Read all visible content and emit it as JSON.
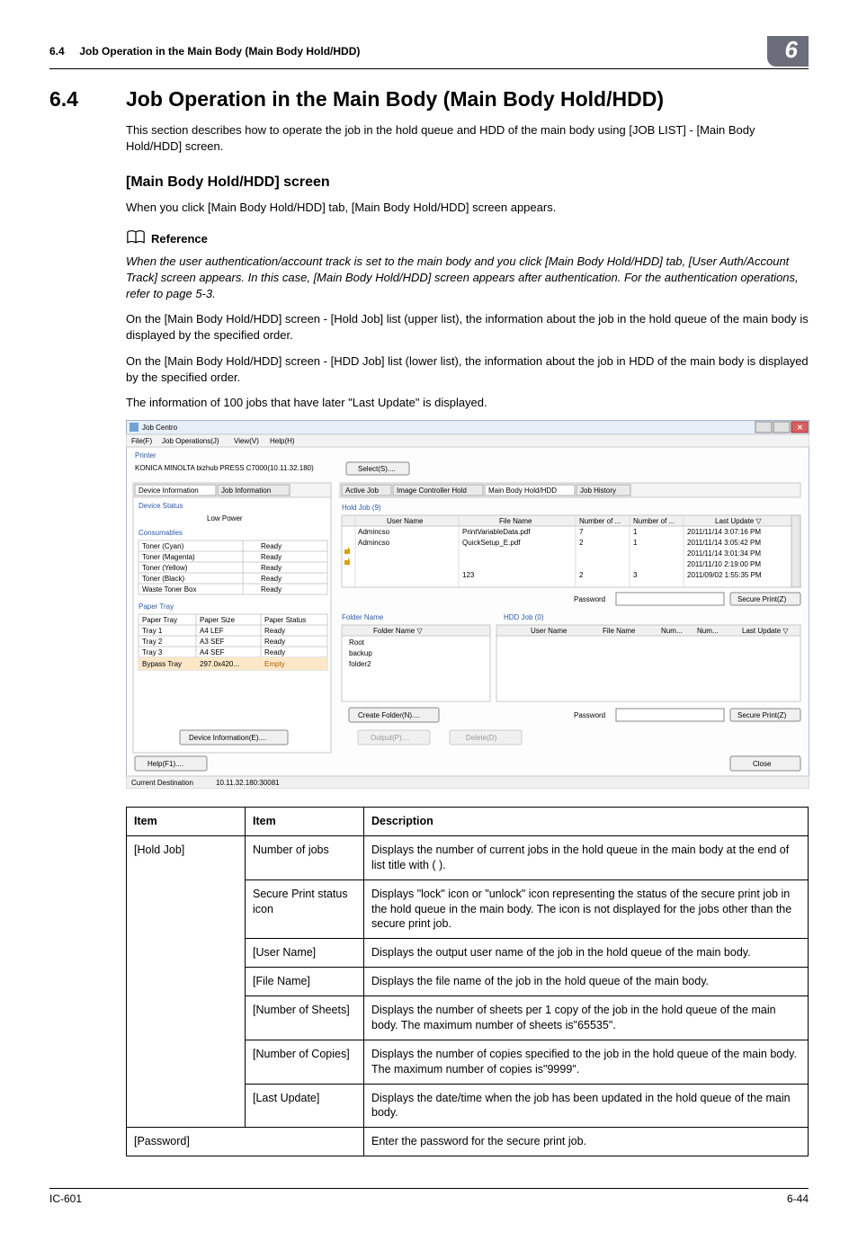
{
  "header": {
    "section_num": "6.4",
    "section_title": "Job Operation in the Main Body (Main Body Hold/HDD)",
    "chapter_badge": "6"
  },
  "title": {
    "num": "6.4",
    "text": "Job Operation in the Main Body (Main Body Hold/HDD)"
  },
  "intro": "This section describes how to operate the job in the hold queue and HDD of the main body using [JOB LIST] - [Main Body Hold/HDD] screen.",
  "sub1": {
    "heading": "[Main Body Hold/HDD] screen",
    "p1": "When you click [Main Body Hold/HDD] tab, [Main Body Hold/HDD] screen appears."
  },
  "reference": {
    "label": "Reference",
    "body": "When the user authentication/account track is set to the main body and you click [Main Body Hold/HDD] tab, [User Auth/Account Track] screen appears. In this case, [Main Body Hold/HDD] screen appears after authentication. For the authentication operations, refer to page 5-3."
  },
  "para2": "On the [Main Body Hold/HDD] screen - [Hold Job] list (upper list), the information about the job in the hold queue of the main body is displayed by the specified order.",
  "para3": "On the [Main Body Hold/HDD] screen - [HDD Job] list (lower list), the information about the job in HDD of the main body is displayed by the specified order.",
  "para4": "The information of 100 jobs that have later \"Last Update\" is displayed.",
  "screenshot": {
    "window_title": "Job Centro",
    "menus": {
      "file": "File(F)",
      "jobop": "Job Operations(J)",
      "view": "View(V)",
      "help": "Help(H)"
    },
    "printer_label": "Printer",
    "printer_name": "KONICA MINOLTA bizhub PRESS C7000(10.11.32.180)",
    "select_btn": "Select(S)....",
    "tabs": {
      "dev_info": "Device Information",
      "job_info": "Job Information",
      "active_job": "Active Job",
      "image_ctrl": "Image Controller Hold",
      "main_body": "Main Body Hold/HDD",
      "job_history": "Job History"
    },
    "device_status": "Device Status",
    "low_power": "Low Power",
    "consumables": "Consumables",
    "toners": [
      {
        "name": "Toner (Cyan)",
        "status": "Ready"
      },
      {
        "name": "Toner (Magenta)",
        "status": "Ready"
      },
      {
        "name": "Toner (Yellow)",
        "status": "Ready"
      },
      {
        "name": "Toner (Black)",
        "status": "Ready"
      },
      {
        "name": "Waste Toner Box",
        "status": "Ready"
      }
    ],
    "paper_tray_label": "Paper Tray",
    "paper_tray_cols": {
      "tray": "Paper Tray",
      "size": "Paper Size",
      "status": "Paper Status"
    },
    "trays": [
      {
        "tray": "Tray 1",
        "size": "A4 LEF",
        "status": "Ready"
      },
      {
        "tray": "Tray 2",
        "size": "A3 SEF",
        "status": "Ready"
      },
      {
        "tray": "Tray 3",
        "size": "A4 SEF",
        "status": "Ready"
      },
      {
        "tray": "Bypass Tray",
        "size": "297.0x420...",
        "status": "Empty"
      }
    ],
    "device_info_btn": "Device Information(E)....",
    "hold_job_label": "Hold Job (9)",
    "hold_cols": {
      "user": "User Name",
      "file": "File Name",
      "sheets": "Number of ...",
      "copies": "Number of ...",
      "last": "Last Update ▽"
    },
    "hold_rows": [
      {
        "user": "Admincso",
        "file": "PrintVariableData.pdf",
        "sheets": "7",
        "copies": "1",
        "last": "2011/11/14 3:07:16 PM"
      },
      {
        "user": "Admincso",
        "file": "QuickSetup_E.pdf",
        "sheets": "2",
        "copies": "1",
        "last": "2011/11/14 3:05:42 PM"
      },
      {
        "user": "",
        "file": "",
        "sheets": "",
        "copies": "",
        "last": "2011/11/14 3:01:34 PM"
      },
      {
        "user": "",
        "file": "",
        "sheets": "",
        "copies": "",
        "last": "2011/11/10 2:19:00 PM"
      },
      {
        "user": "",
        "file": "123",
        "sheets": "2",
        "copies": "3",
        "last": "2011/09/02 1:55:35 PM"
      }
    ],
    "password_label": "Password",
    "secure_print_btn": "Secure Print(Z)",
    "folder_name_label": "Folder Name",
    "hdd_job_label": "HDD Job (0)",
    "folder_col": "Folder Name ▽",
    "folders": [
      "Root",
      "backup",
      "folder2"
    ],
    "hdd_cols": {
      "user": "User Name",
      "file": "File Name",
      "num1": "Num...",
      "num2": "Num...",
      "last": "Last Update ▽"
    },
    "create_folder_btn": "Create Folder(N)....",
    "output_btn": "Output(P)....",
    "delete_btn": "Delete(D)",
    "help_btn": "Help(F1)....",
    "close_btn": "Close",
    "status_bar_label": "Current Destination",
    "status_bar_value": "10.11.32.180:30081"
  },
  "table": {
    "headers": {
      "h1": "Item",
      "h2": "Item",
      "h3": "Description"
    },
    "rows": [
      {
        "c1": "[Hold Job]",
        "c2": "Number of jobs",
        "c3": "Displays the number of current jobs in the hold queue in the main body at the end of list title with (  )."
      },
      {
        "c1": "",
        "c2": "Secure Print status icon",
        "c3": "Displays \"lock\" icon or \"unlock\" icon representing the status of the secure print job in the hold queue in the main body. The icon is not displayed for the jobs other than the secure print job."
      },
      {
        "c1": "",
        "c2": "[User Name]",
        "c3": "Displays the output user name of the job in the hold queue of the main body."
      },
      {
        "c1": "",
        "c2": "[File Name]",
        "c3": "Displays the file name of the job in the hold queue of the main body."
      },
      {
        "c1": "",
        "c2": "[Number of Sheets]",
        "c3": "Displays the number of sheets per 1 copy of the job in the hold queue of the main body. The maximum number of sheets is\"65535\"."
      },
      {
        "c1": "",
        "c2": "[Number of Copies]",
        "c3": "Displays the number of copies specified to the job in the hold queue of the main body. The maximum number of copies is\"9999\"."
      },
      {
        "c1": "",
        "c2": "[Last Update]",
        "c3": "Displays the date/time when the job has been updated in the hold queue of the main body."
      },
      {
        "c1": "[Password]",
        "c2": "",
        "c3": "Enter the password for the secure print job.",
        "span": true
      }
    ]
  },
  "footer": {
    "left": "IC-601",
    "right": "6-44"
  }
}
